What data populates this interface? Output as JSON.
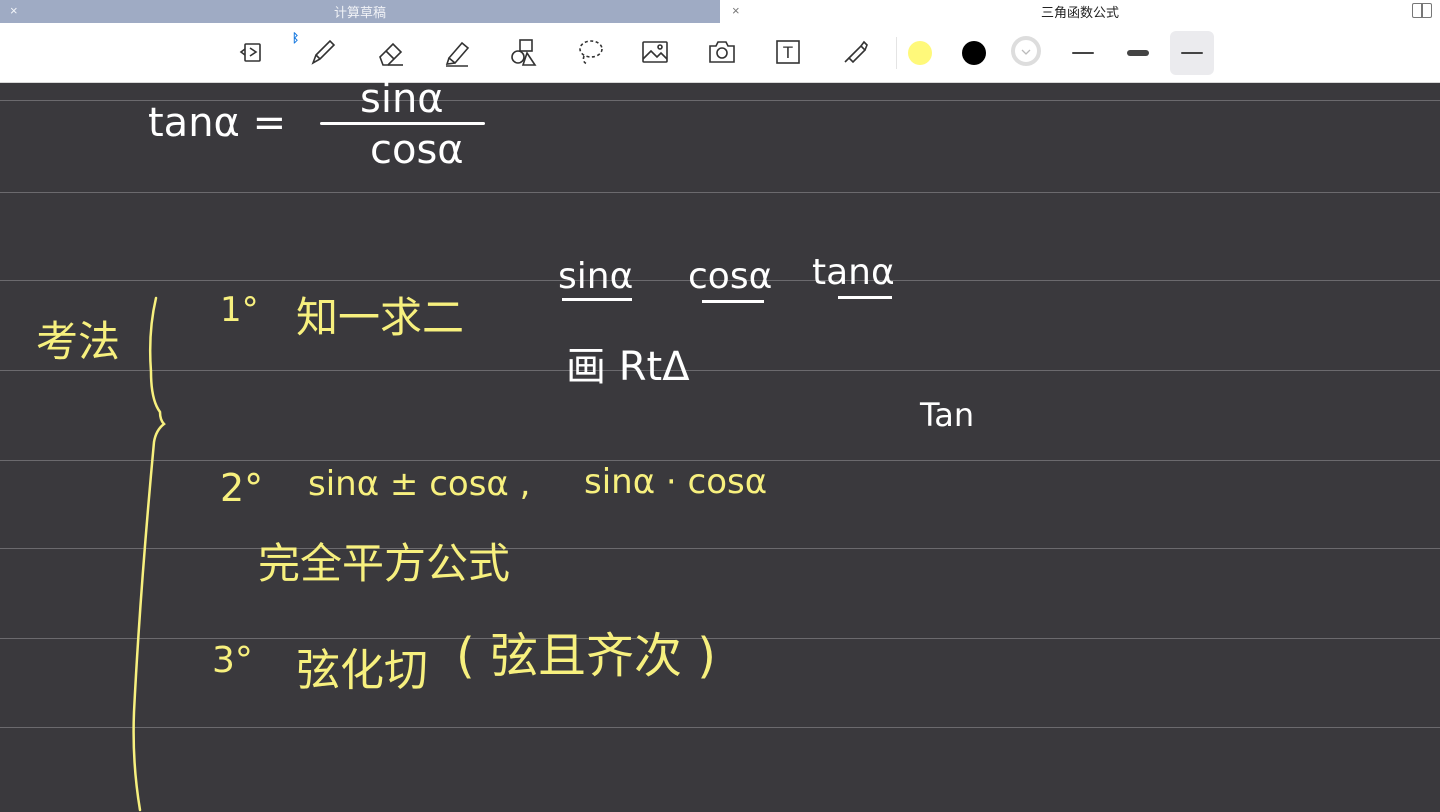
{
  "tabs": [
    {
      "title": "计算草稿",
      "close": "×"
    },
    {
      "title": "三角函数公式",
      "close": "×"
    }
  ],
  "toolbar": {
    "tools": [
      "view-mode-icon",
      "pen-icon",
      "eraser-icon",
      "highlighter-icon",
      "shapes-icon",
      "lasso-icon",
      "image-icon",
      "camera-icon",
      "textbox-icon",
      "laser-pointer-icon"
    ],
    "bluetooth_badge": "ᛒ",
    "textbox_glyph": "T",
    "colors": {
      "yellow": "#fff97a",
      "black": "#000000",
      "custom": "#ffffff"
    },
    "stroke_widths": [
      "thin",
      "medium",
      "thin-selected"
    ]
  },
  "notes": {
    "tan_formula_lhs": "tanα =",
    "tan_formula_num": "sinα",
    "tan_formula_den": "cosα",
    "method_label": "考法",
    "item1_num": "1°",
    "item1_text": "知一求二",
    "trio_sin": "sinα",
    "trio_cos": "cosα",
    "trio_tan": "tanα",
    "draw_triangle": "画 RtΔ",
    "tan_note": "Tan",
    "item2_num": "2°",
    "item2_expr1": "sinα ± cosα ,",
    "item2_expr2": "sinα · cosα",
    "item2_sub": "完全平方公式",
    "item3_num": "3°",
    "item3_text": "弦化切",
    "item3_paren": "( 弦且齐次 )"
  }
}
